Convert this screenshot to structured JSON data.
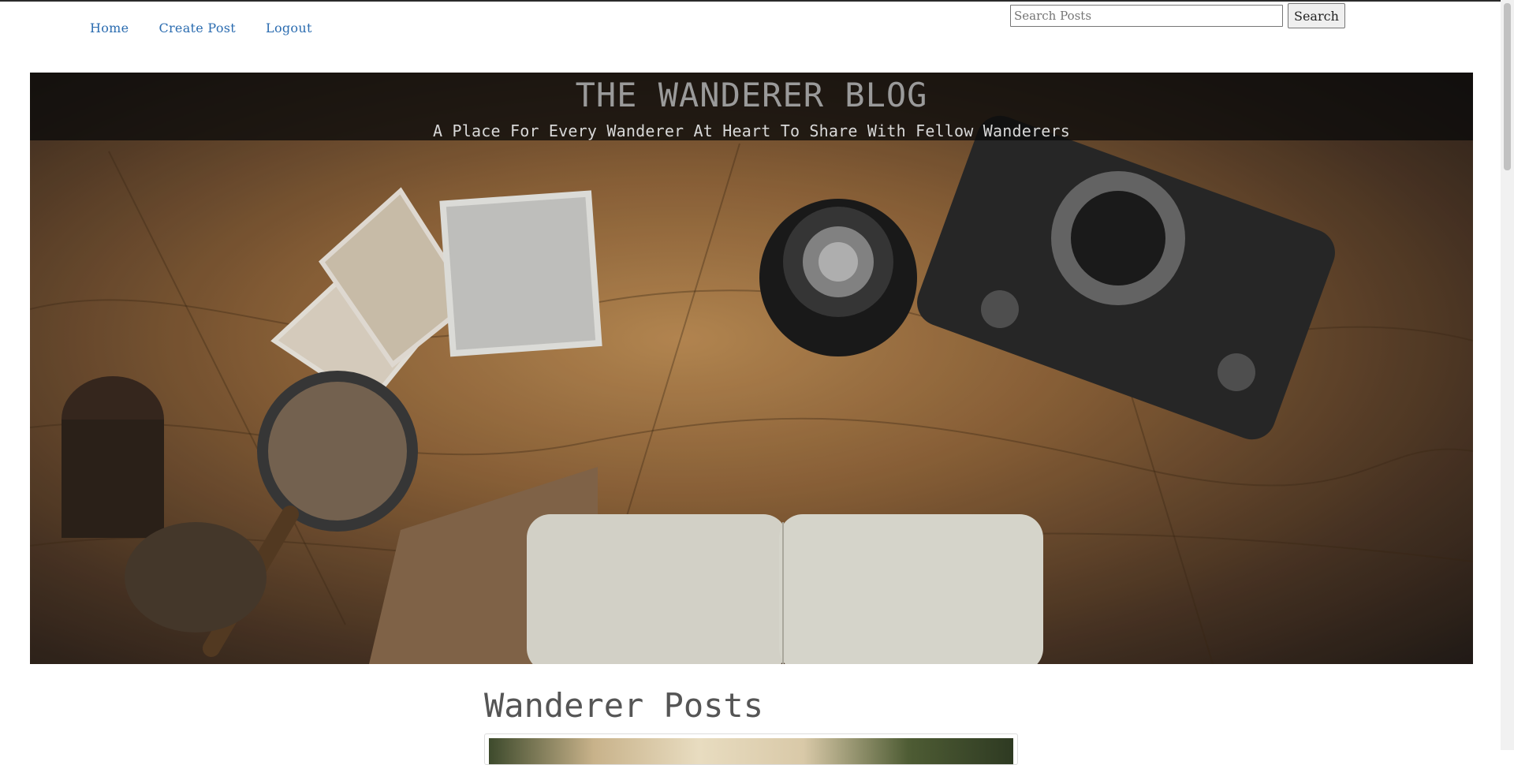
{
  "nav": {
    "links": [
      {
        "label": "Home"
      },
      {
        "label": "Create Post"
      },
      {
        "label": "Logout"
      }
    ]
  },
  "search": {
    "placeholder": "Search Posts",
    "value": "",
    "button_label": "Search"
  },
  "hero": {
    "title": "THE WANDERER BLOG",
    "subtitle": "A Place For Every Wanderer At Heart To Share With Fellow Wanderers",
    "image_subject": "vintage map with camera, lens, magnifying glass, postcards and open notebook"
  },
  "main": {
    "section_title": "Wanderer Posts"
  },
  "colors": {
    "nav_link": "#2b6cb0",
    "title_band": "#0a0a0a",
    "hero_title": "#9a9a9a",
    "section_title": "#555555"
  }
}
